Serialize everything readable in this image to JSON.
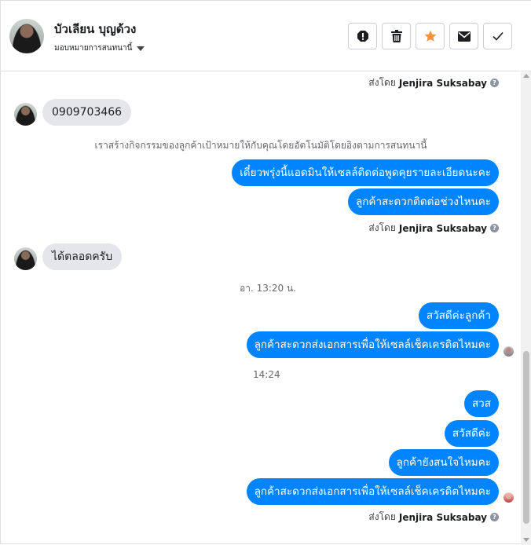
{
  "header": {
    "contact_name": "บัวเลียน บุญด้วง",
    "assign_label": "มอบหมายการสนทนานี้",
    "actions": [
      {
        "name": "spam-icon",
        "color": "#1c1e21"
      },
      {
        "name": "trash-icon",
        "color": "#1c1e21"
      },
      {
        "name": "star-icon",
        "color": "#f7923b"
      },
      {
        "name": "envelope-icon",
        "color": "#1c1e21"
      },
      {
        "name": "check-icon",
        "color": "#1c1e21"
      }
    ]
  },
  "sent_by": {
    "label": "ส่งโดย",
    "agent": "Jenjira Suksabay",
    "icon": "info-icon"
  },
  "messages": {
    "in_1": "0909703466",
    "system_note": "เราสร้างกิจกรรมของลูกค้าเป้าหมายให้กับคุณโดยอัตโนมัติโดยอิงตามการสนทนานี้",
    "out_1": "เดี๋ยวพรุ่งนี้แอดมินให้เซลล์ติดต่อพูดคุยรายละเอียดนะคะ",
    "out_2": "ลูกค้าสะดวกติดต่อช่วงไหนคะ",
    "in_2": "ได้ตลอดครับ",
    "time_1": "อา. 13:20 น.",
    "out_3": "สวัสดีค่ะลูกค้า",
    "out_4": "ลูกค้าสะดวกส่งเอกสารเพื่อให้เซลล์เช็คเครดิตไหมคะ",
    "time_2": "14:24",
    "out_5": "สวส",
    "out_6": "สวัสดีค่ะ",
    "out_7": "ลูกค้ายังสนใจไหมคะ",
    "out_8": "ลูกค้าสะดวกส่งเอกสารเพื่อให้เซลล์เช็คเครดิตไหมคะ"
  },
  "colors": {
    "outgoing_bubble": "#0084ff",
    "incoming_bubble": "#e4e6eb",
    "star_accent": "#f7923b"
  }
}
